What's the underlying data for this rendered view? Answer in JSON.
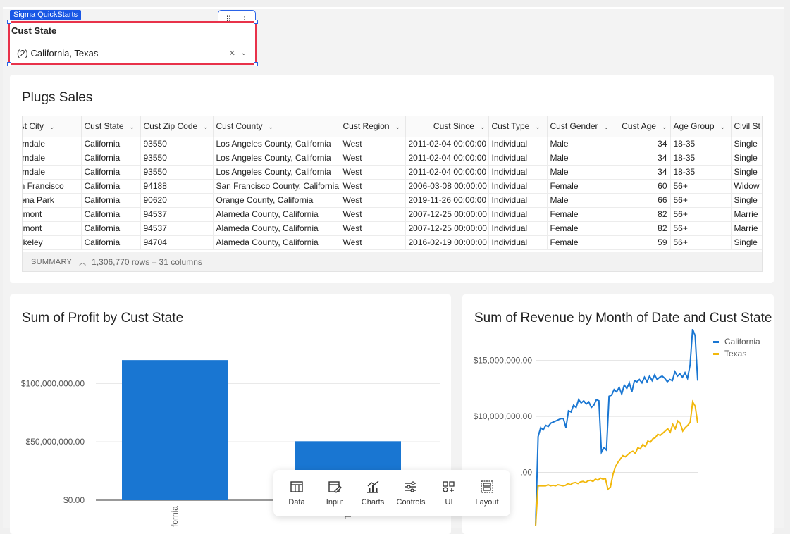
{
  "control": {
    "tag": "Sigma QuickStarts",
    "label": "Cust State",
    "value": "(2) California, Texas"
  },
  "table": {
    "title": "Plugs Sales",
    "columns": [
      "ust City",
      "Cust State",
      "Cust Zip Code",
      "Cust County",
      "Cust Region",
      "Cust Since",
      "Cust Type",
      "Cust Gender",
      "Cust Age",
      "Age Group",
      "Civil St"
    ],
    "rows": [
      [
        "almdale",
        "California",
        "93550",
        "Los Angeles County, California",
        "West",
        "2011-02-04 00:00:00",
        "Individual",
        "Male",
        "34",
        "18-35",
        "Single"
      ],
      [
        "almdale",
        "California",
        "93550",
        "Los Angeles County, California",
        "West",
        "2011-02-04 00:00:00",
        "Individual",
        "Male",
        "34",
        "18-35",
        "Single"
      ],
      [
        "almdale",
        "California",
        "93550",
        "Los Angeles County, California",
        "West",
        "2011-02-04 00:00:00",
        "Individual",
        "Male",
        "34",
        "18-35",
        "Single"
      ],
      [
        "an Francisco",
        "California",
        "94188",
        "San Francisco County, California",
        "West",
        "2006-03-08 00:00:00",
        "Individual",
        "Female",
        "60",
        "56+",
        "Widow"
      ],
      [
        "uena Park",
        "California",
        "90620",
        "Orange County, California",
        "West",
        "2019-11-26 00:00:00",
        "Individual",
        "Male",
        "66",
        "56+",
        "Single"
      ],
      [
        "remont",
        "California",
        "94537",
        "Alameda County, California",
        "West",
        "2007-12-25 00:00:00",
        "Individual",
        "Female",
        "82",
        "56+",
        "Marrie"
      ],
      [
        "remont",
        "California",
        "94537",
        "Alameda County, California",
        "West",
        "2007-12-25 00:00:00",
        "Individual",
        "Female",
        "82",
        "56+",
        "Marrie"
      ],
      [
        "erkeley",
        "California",
        "94704",
        "Alameda County, California",
        "West",
        "2016-02-19 00:00:00",
        "Individual",
        "Female",
        "59",
        "56+",
        "Single"
      ]
    ],
    "summary_label": "SUMMARY",
    "summary_text": "1,306,770 rows – 31 columns"
  },
  "chart_data": [
    {
      "type": "bar",
      "title": "Sum of Profit by Cust State",
      "categories": [
        "fornia",
        "Tex"
      ],
      "values": [
        120000000,
        50500000
      ],
      "ylim": [
        0,
        140000000
      ],
      "yticks": [
        0,
        50000000,
        100000000
      ],
      "ytick_labels": [
        "$0.00",
        "$50,000,000.00",
        "$100,000,000.00"
      ],
      "color": "#1976d2"
    },
    {
      "type": "line",
      "title": "Sum of Revenue by Month of Date and Cust State",
      "ylim": [
        0,
        18000000
      ],
      "yticks": [
        5000000,
        10000000,
        15000000
      ],
      "ytick_labels": [
        ".00",
        "$10,000,000.00",
        "$15,000,000.00"
      ],
      "legend_position": "top-right",
      "series": [
        {
          "name": "California",
          "color": "#1976d2",
          "values": [
            200000,
            8200000,
            9000000,
            8800000,
            9200000,
            9100000,
            9400000,
            9500000,
            9600000,
            9700000,
            9800000,
            9800000,
            9000000,
            10500000,
            10400000,
            11000000,
            10800000,
            11500000,
            11200000,
            11400000,
            11100000,
            11300000,
            10800000,
            11000000,
            11500000,
            11400000,
            6800000,
            7200000,
            7000000,
            11800000,
            11900000,
            12400000,
            12200000,
            12600000,
            12000000,
            12800000,
            12500000,
            13000000,
            12200000,
            13200000,
            13100000,
            13300000,
            13000000,
            13500000,
            13100000,
            13600000,
            13200000,
            13700000,
            13300000,
            13500000,
            13600000,
            13400000,
            13100000,
            13300000,
            13200000,
            14000000,
            13600000,
            13800000,
            13500000,
            13900000,
            13400000,
            14600000,
            17800000,
            17200000,
            13200000
          ]
        },
        {
          "name": "Texas",
          "color": "#f2b80c",
          "values": [
            200000,
            3800000,
            3800000,
            3800000,
            3800000,
            3900000,
            3800000,
            3850000,
            3800000,
            3900000,
            3850000,
            3800000,
            3850000,
            4000000,
            3900000,
            4050000,
            4100000,
            4000000,
            4150000,
            4200000,
            4100000,
            4250000,
            4300000,
            4200000,
            4400000,
            4300000,
            4500000,
            4400000,
            4450000,
            3500000,
            3700000,
            4800000,
            5500000,
            5900000,
            6200000,
            6500000,
            6400000,
            6600000,
            6800000,
            6900000,
            6700000,
            7200000,
            7100000,
            7500000,
            7300000,
            7800000,
            7700000,
            8000000,
            8100000,
            8400000,
            8300000,
            8500000,
            8700000,
            8900000,
            8600000,
            9300000,
            8900000,
            9600000,
            9400000,
            8700000,
            9000000,
            9200000,
            9500000,
            11300000,
            10900000,
            9400000
          ]
        }
      ]
    }
  ],
  "toolbar": {
    "items": [
      {
        "label": "Data",
        "icon": "table-icon"
      },
      {
        "label": "Input",
        "icon": "edit-table-icon"
      },
      {
        "label": "Charts",
        "icon": "chart-icon"
      },
      {
        "label": "Controls",
        "icon": "sliders-icon"
      },
      {
        "label": "UI",
        "icon": "ui-elements-icon"
      },
      {
        "label": "Layout",
        "icon": "layout-icon"
      }
    ]
  }
}
